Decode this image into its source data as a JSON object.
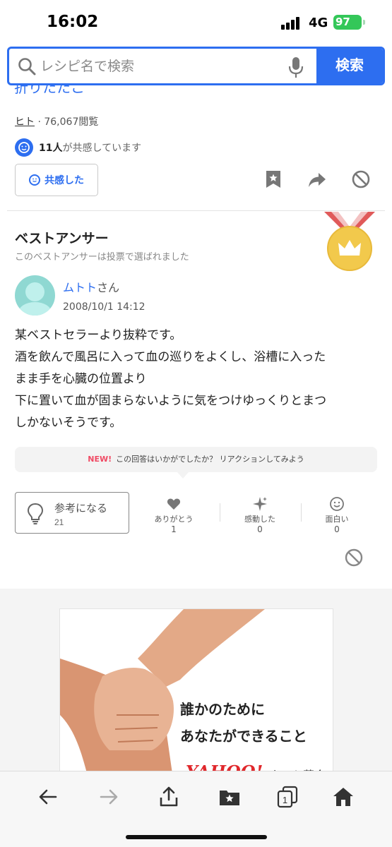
{
  "status_bar": {
    "time": "16:02",
    "network": "4G",
    "battery": "97"
  },
  "search": {
    "placeholder": "レシピ名で検索",
    "button_label": "検索"
  },
  "prev_answer": {
    "cut_text": "折りたたこ",
    "author": "ヒト",
    "views": "76,067閲覧",
    "empathy_count": "11人",
    "empathy_suffix": "が共感しています",
    "empathy_button": "共感した"
  },
  "best_answer": {
    "heading": "ベストアンサー",
    "subheading": "このベストアンサーは投票で選ばれました",
    "user_name": "ムトト",
    "user_suffix": "さん",
    "date": "2008/10/1 14:12",
    "body": [
      "某ベストセラーより抜粋です。",
      "酒を飲んで風呂に入って血の巡りをよくし、浴槽に入った",
      "まま手を心臓の位置より",
      "下に置いて血が固まらないように気をつけゆっくりとまつ",
      "しかないそうです。"
    ],
    "new_badge": "NEW!",
    "new_prompt": "この回答はいかがでしたか？ リアクションしてみよう",
    "helpful_label": "参考になる",
    "helpful_count": "21",
    "reactions": [
      {
        "label": "ありがとう",
        "count": "1",
        "icon": "heart-icon"
      },
      {
        "label": "感動した",
        "count": "0",
        "icon": "sparkle-icon"
      },
      {
        "label": "面白い",
        "count": "0",
        "icon": "smile-icon"
      }
    ]
  },
  "ad": {
    "line1": "誰かのために",
    "line2": "あなたができること",
    "logo": "YAHOO!",
    "logo_rest": "ネット募金"
  },
  "bottom_nav": {
    "icons": [
      "back-arrow-icon",
      "forward-arrow-icon",
      "share-icon",
      "bookmarks-icon",
      "tabs-icon",
      "home-icon"
    ],
    "tab_count": "1"
  },
  "colors": {
    "accent": "#2d6ef0",
    "new": "#f04a64",
    "battery": "#34c759",
    "medal": "#f2c94c"
  }
}
